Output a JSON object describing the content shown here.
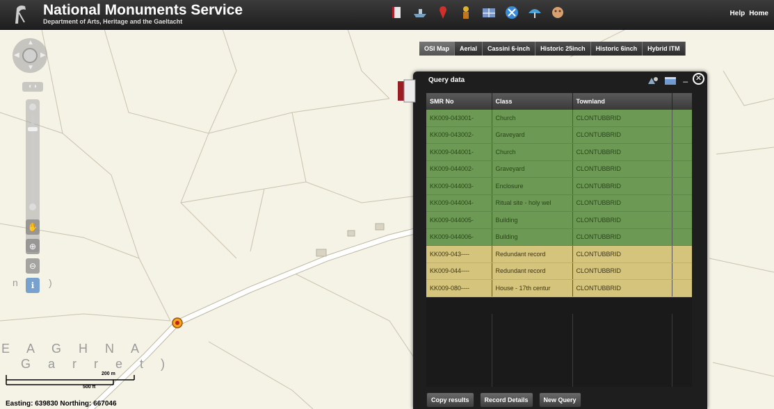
{
  "header": {
    "title": "National Monuments Service",
    "subtitle": "Department of Arts, Heritage and the Gaeltacht",
    "tool_icons": [
      "book-icon",
      "ship-icon",
      "pin-icon",
      "person-icon",
      "grid-icon",
      "compass-icon",
      "umbrella-icon",
      "head-icon"
    ],
    "links": [
      "Help",
      "Home"
    ]
  },
  "basemap_tabs": [
    "OSI Map",
    "Aerial",
    "Cassini 6-inch",
    "Historic 25inch",
    "Historic 6inch",
    "Hybrid ITM"
  ],
  "map": {
    "place_line1": "E A G H N A",
    "place_line2": "G a r r e t )",
    "place_left": "n",
    "place_left2": ")"
  },
  "query_panel": {
    "title": "Query data",
    "columns": [
      "SMR No",
      "Class",
      "Townland"
    ],
    "rows": [
      {
        "smr": "KK009-043001-",
        "class": "Church",
        "townland": "CLONTUBBRID",
        "status": "green"
      },
      {
        "smr": "KK009-043002-",
        "class": "Graveyard",
        "townland": "CLONTUBBRID",
        "status": "green"
      },
      {
        "smr": "KK009-044001-",
        "class": "Church",
        "townland": "CLONTUBBRID",
        "status": "green"
      },
      {
        "smr": "KK009-044002-",
        "class": "Graveyard",
        "townland": "CLONTUBBRID",
        "status": "green"
      },
      {
        "smr": "KK009-044003-",
        "class": "Enclosure",
        "townland": "CLONTUBBRID",
        "status": "green"
      },
      {
        "smr": "KK009-044004-",
        "class": "Ritual site - holy wel",
        "townland": "CLONTUBBRID",
        "status": "green"
      },
      {
        "smr": "KK009-044005-",
        "class": "Building",
        "townland": "CLONTUBBRID",
        "status": "green"
      },
      {
        "smr": "KK009-044006-",
        "class": "Building",
        "townland": "CLONTUBBRID",
        "status": "green"
      },
      {
        "smr": "KK009-043----",
        "class": "Redundant record",
        "townland": "CLONTUBBRID",
        "status": "yellow"
      },
      {
        "smr": "KK009-044----",
        "class": "Redundant record",
        "townland": "CLONTUBBRID",
        "status": "yellow"
      },
      {
        "smr": "KK009-080----",
        "class": "House - 17th centur",
        "townland": "CLONTUBBRID",
        "status": "yellow"
      }
    ],
    "buttons": {
      "copy": "Copy results",
      "details": "Record Details",
      "new_query": "New Query"
    }
  },
  "scale": {
    "metric": "200 m",
    "imperial": "500 ft"
  },
  "coords": {
    "text": "Easting: 639830 Northing: 667046"
  },
  "colors": {
    "green_row": "#6c9a54",
    "yellow_row": "#d4c47c",
    "header_bg": "#2b2b2b",
    "panel_bg": "#1e1e1e"
  }
}
